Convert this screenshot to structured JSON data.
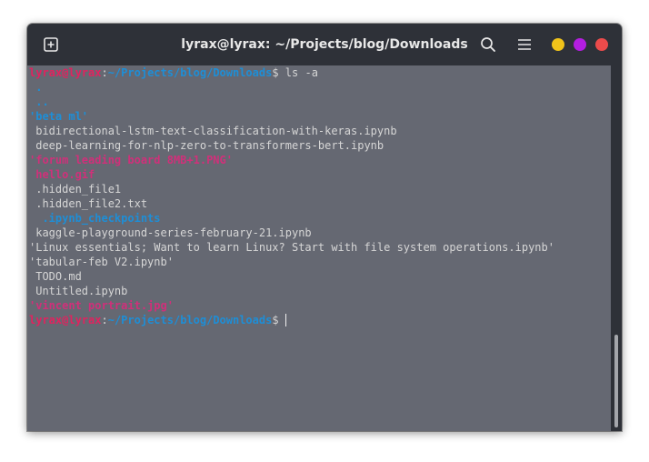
{
  "window": {
    "title": "lyrax@lyrax: ~/Projects/blog/Downloads",
    "buttons": {
      "new_tab_icon": "plus-square-icon",
      "search_icon": "search-icon",
      "menu_icon": "hamburger-menu-icon",
      "minimize_color": "#f0c31a",
      "maximize_color": "#b31ee0",
      "close_color": "#eb4b4b"
    }
  },
  "terminal": {
    "prompt": {
      "user": "lyrax@lyrax",
      "colon": ":",
      "path": "~/Projects/blog/Downloads",
      "symbol": "$"
    },
    "command": " ls -a",
    "listing": [
      {
        "text": " .",
        "type": "dir"
      },
      {
        "text": " ..",
        "type": "dir"
      },
      {
        "text": "'beta ml'",
        "type": "dir"
      },
      {
        "text": " bidirectional-lstm-text-classification-with-keras.ipynb",
        "type": "plain"
      },
      {
        "text": " deep-learning-for-nlp-zero-to-transformers-bert.ipynb",
        "type": "plain"
      },
      {
        "text": "'forum leading board 8MB+1.PNG'",
        "type": "img"
      },
      {
        "text": " hello.gif",
        "type": "img"
      },
      {
        "text": " .hidden_file1",
        "type": "plain"
      },
      {
        "text": " .hidden_file2.txt",
        "type": "plain"
      },
      {
        "text": "  .ipynb_checkpoints",
        "type": "dir"
      },
      {
        "text": " kaggle-playground-series-february-21.ipynb",
        "type": "plain"
      },
      {
        "text": "'Linux essentials; Want to learn Linux? Start with file system operations.ipynb'",
        "type": "plain"
      },
      {
        "text": "'tabular-feb V2.ipynb'",
        "type": "plain"
      },
      {
        "text": " TODO.md",
        "type": "plain"
      },
      {
        "text": " Untitled.ipynb",
        "type": "plain"
      },
      {
        "text": "'vincent portrait.jpg'",
        "type": "img"
      }
    ],
    "colors": {
      "background": "#656872",
      "user": "#e0235f",
      "path": "#1e8ed6",
      "text": "#d6d6d6"
    }
  }
}
